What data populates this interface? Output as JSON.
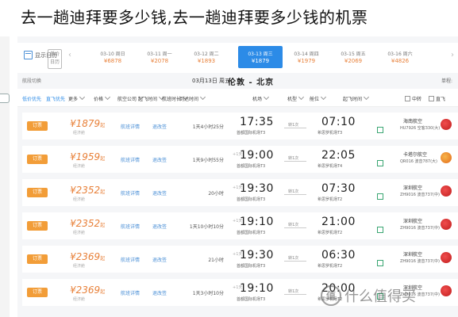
{
  "title": "去一趟迪拜要多少钱,去一趟迪拜要多少钱的机票",
  "date_bar": {
    "calendar_label": "显示日历",
    "low_price_label": "低价日历",
    "dates": [
      {
        "date": "03-10 周日",
        "price": "¥6878"
      },
      {
        "date": "03-11 周一",
        "price": "¥2078"
      },
      {
        "date": "03-12 周二",
        "price": "¥1893"
      },
      {
        "date": "03-13 周三",
        "price": "¥1879",
        "active": true
      },
      {
        "date": "03-14 周四",
        "price": "¥1979"
      },
      {
        "date": "03-15 周五",
        "price": "¥2069"
      },
      {
        "date": "03-16 周六",
        "price": "¥4826"
      }
    ],
    "prev_arrow": "‹",
    "next_arrow": "›"
  },
  "route_bar": {
    "left_label": "航段切换",
    "date": "03月13日 周五",
    "route": "伦敦 - 北京",
    "unit": "单程:"
  },
  "filters": [
    {
      "label": "起飞时间",
      "type": "dropdown"
    },
    {
      "label": "航空公司",
      "type": "dropdown"
    },
    {
      "label": "机场",
      "type": "dropdown"
    },
    {
      "label": "舱位",
      "type": "dropdown"
    },
    {
      "label": "价格",
      "type": "dropdown"
    },
    {
      "label": "到达时间",
      "type": "dropdown"
    },
    {
      "label": "航班时长",
      "type": "dropdown"
    },
    {
      "label": "起飞时间",
      "type": "dropdown"
    },
    {
      "label": "更多",
      "type": "dropdown"
    },
    {
      "label": "直飞",
      "type": "checkbox"
    },
    {
      "label": "中转",
      "type": "checkbox"
    },
    {
      "label": "机型",
      "type": "dropdown"
    },
    {
      "label": "低价优先",
      "type": "link"
    },
    {
      "label": "直飞优先",
      "type": "link"
    }
  ],
  "flights": [
    {
      "buy": "订票",
      "price": "¥1879",
      "suffix": "起",
      "seats": "经济舱",
      "detail": "航班详情",
      "detail2": "退改签",
      "duration": "1天4小时25分",
      "cross_day": "",
      "arrive": "17:35",
      "arrive_airport": "首都国际机场T3",
      "via": "转1次",
      "depart": "07:10",
      "depart_airport": "希思罗机场T3",
      "airline": "海南航空",
      "flight_no": "HU7926 空客330(大)",
      "logo": "red"
    },
    {
      "buy": "订票",
      "price": "¥1959",
      "suffix": "起",
      "seats": "经济舱",
      "detail": "航班详情",
      "detail2": "退改签",
      "duration": "1天9小时55分",
      "cross_day": "+1天",
      "arrive": "19:00",
      "arrive_airport": "首都国际机场T3",
      "via": "转1次",
      "depart": "22:05",
      "depart_airport": "希思罗机场T4",
      "airline": "卡塔尔航空",
      "flight_no": "QR016 波音787(大)",
      "logo": "orange"
    },
    {
      "buy": "订票",
      "price": "¥2352",
      "suffix": "起",
      "seats": "经济舱",
      "detail": "航班详情",
      "detail2": "退改签",
      "duration": "20小时",
      "cross_day": "+1天",
      "arrive": "19:30",
      "arrive_airport": "首都国际机场T3",
      "via": "转1次",
      "depart": "07:30",
      "depart_airport": "希思罗机场T2",
      "airline": "深圳航空",
      "flight_no": "ZH9016 波音737(中)",
      "logo": "red"
    },
    {
      "buy": "订票",
      "price": "¥2352",
      "suffix": "起",
      "seats": "经济舱",
      "detail": "航班详情",
      "detail2": "退改签",
      "duration": "1天10小时10分",
      "cross_day": "+1天",
      "arrive": "19:10",
      "arrive_airport": "首都国际机场T3",
      "via": "转1次",
      "depart": "21:00",
      "depart_airport": "希思罗机场T2",
      "airline": "深圳航空",
      "flight_no": "ZH9016 波音737(中)",
      "logo": "red"
    },
    {
      "buy": "订票",
      "price": "¥2369",
      "suffix": "起",
      "seats": "经济舱",
      "detail": "航班详情",
      "detail2": "退改签",
      "duration": "21小时",
      "cross_day": "+1天",
      "arrive": "19:30",
      "arrive_airport": "首都国际机场T3",
      "via": "转1次",
      "depart": "06:30",
      "depart_airport": "希思罗机场T2",
      "airline": "深圳航空",
      "flight_no": "ZH9016 波音737(中)",
      "logo": "red"
    },
    {
      "buy": "订票",
      "price": "¥2369",
      "suffix": "起",
      "seats": "经济舱",
      "detail": "航班详情",
      "detail2": "退改签",
      "duration": "1天3小时10分",
      "cross_day": "+1天",
      "arrive": "19:10",
      "arrive_airport": "首都国际机场T3",
      "via": "转1次",
      "depart": "20:00",
      "depart_airport": "希思罗机场T2",
      "airline": "深圳航空",
      "flight_no": "ZH9016 波音737(中)",
      "logo": "red"
    }
  ],
  "watermark": {
    "icon": "值",
    "text": "什么值得买"
  }
}
